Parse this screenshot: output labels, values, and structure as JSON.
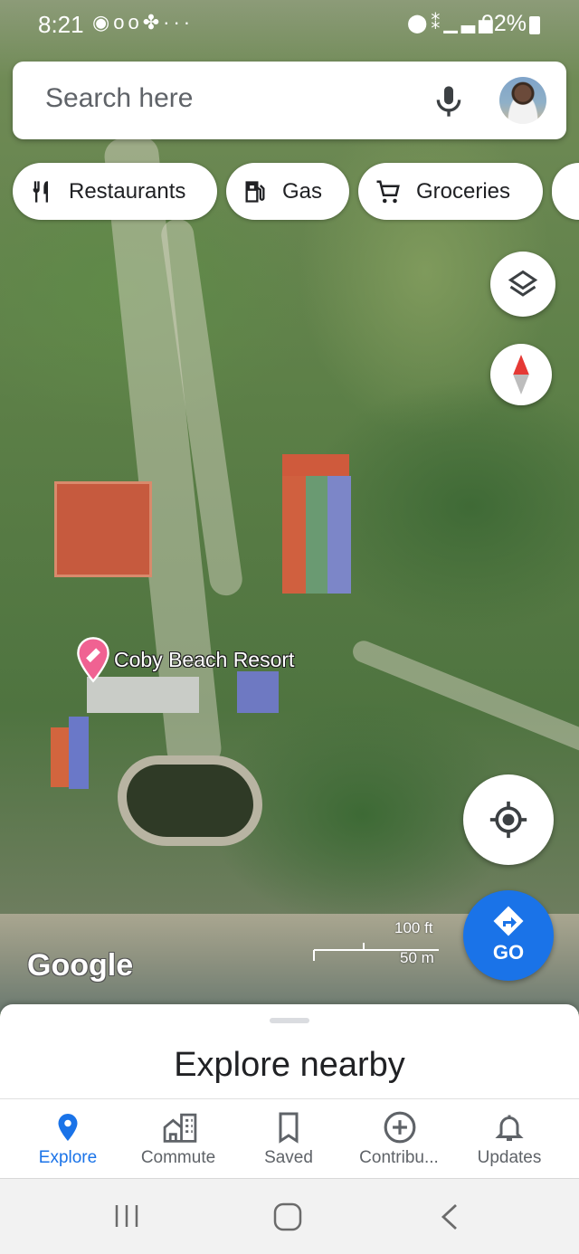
{
  "status_bar": {
    "time": "8:21",
    "battery": "92%",
    "left_icons": [
      "messenger-icon",
      "voicemail-icon",
      "app-icon",
      "more-icon"
    ],
    "right_icons": [
      "location-icon",
      "vibrate-icon",
      "signal-icon",
      "battery-icon"
    ]
  },
  "search": {
    "placeholder": "Search here",
    "mic_icon": "mic-icon",
    "avatar": "account-avatar"
  },
  "chips": [
    {
      "label": "Restaurants",
      "icon": "fork-knife-icon"
    },
    {
      "label": "Gas",
      "icon": "gas-station-icon"
    },
    {
      "label": "Groceries",
      "icon": "shopping-cart-icon"
    }
  ],
  "map": {
    "place_label": "Coby Beach Resort",
    "place_pin_color": "#f06292",
    "logo": "Google",
    "scale_ft": "100 ft",
    "scale_m": "50 m",
    "layers_icon": "layers-icon",
    "compass_icon": "compass-icon",
    "location_icon": "my-location-icon"
  },
  "go_button": {
    "label": "GO",
    "color": "#1a73e8"
  },
  "sheet": {
    "title": "Explore nearby"
  },
  "nav": {
    "items": [
      {
        "label": "Explore",
        "icon": "pin-icon",
        "active": true
      },
      {
        "label": "Commute",
        "icon": "commute-icon",
        "active": false
      },
      {
        "label": "Saved",
        "icon": "bookmark-icon",
        "active": false
      },
      {
        "label": "Contribu...",
        "icon": "add-circle-icon",
        "active": false
      },
      {
        "label": "Updates",
        "icon": "bell-icon",
        "active": false
      }
    ],
    "accent": "#1a73e8"
  },
  "android_nav": [
    "recents-icon",
    "home-icon",
    "back-icon"
  ]
}
